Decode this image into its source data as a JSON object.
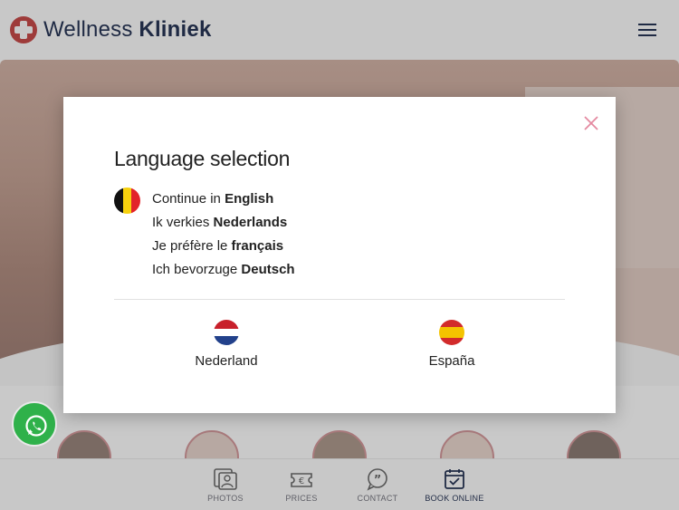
{
  "header": {
    "brand_light": "Wellness",
    "brand_bold": "Kliniek",
    "logo_icon": "cross-logo-icon",
    "menu_icon": "hamburger-icon"
  },
  "modal": {
    "title": "Language selection",
    "close_icon": "close-icon",
    "languages": [
      {
        "prefix": "Continue in ",
        "language": "English"
      },
      {
        "prefix": "Ik verkies ",
        "language": "Nederlands"
      },
      {
        "prefix": "Je préfère le ",
        "language": "français"
      },
      {
        "prefix": "Ich bevorzuge ",
        "language": "Deutsch"
      }
    ],
    "sites": [
      {
        "label": "Nederland",
        "flag": "netherlands-flag-icon"
      },
      {
        "label": "España",
        "flag": "spain-flag-icon"
      }
    ]
  },
  "bottom_nav": [
    {
      "label": "PHOTOS",
      "icon": "photos-icon"
    },
    {
      "label": "PRICES",
      "icon": "euro-icon"
    },
    {
      "label": "CONTACT",
      "icon": "chat-quote-icon"
    },
    {
      "label": "BOOK ONLINE",
      "icon": "calendar-check-icon"
    }
  ],
  "colors": {
    "brand_navy": "#1f2a44",
    "logo_red": "#9e3b3a",
    "close_pink": "#e48aa0",
    "whatsapp_green": "#2fb14a"
  }
}
